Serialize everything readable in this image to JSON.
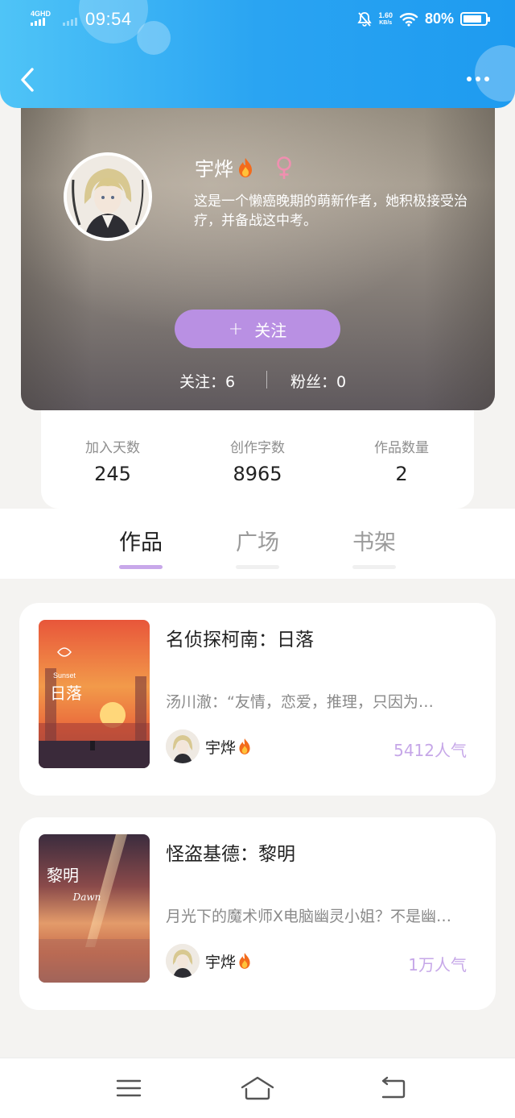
{
  "status_bar": {
    "network": "4GHD",
    "time": "09:54",
    "speed_value": "1.60",
    "speed_unit": "KB/s",
    "battery": "80%"
  },
  "profile": {
    "name": "宇烨",
    "bio": "这是一个懒癌晚期的萌新作者，她积极接受治疗，并备战这中考。",
    "follow_button": "关注",
    "following": "关注：6",
    "fans": "粉丝：0"
  },
  "stats": [
    {
      "label": "加入天数",
      "value": "245"
    },
    {
      "label": "创作字数",
      "value": "8965"
    },
    {
      "label": "作品数量",
      "value": "2"
    }
  ],
  "tabs": [
    {
      "label": "作品",
      "active": true
    },
    {
      "label": "广场",
      "active": false
    },
    {
      "label": "书架",
      "active": false
    }
  ],
  "works": [
    {
      "title": "名侦探柯南：日落",
      "description": "汤川澈：“友情，恋爱，推理，只因为…",
      "author": "宇烨",
      "popularity": "5412人气",
      "cover_text": "日落",
      "cover_sub": "Sunset"
    },
    {
      "title": "怪盗基德：黎明",
      "description": "月光下的魔术师X电脑幽灵小姐？不是幽…",
      "author": "宇烨",
      "popularity": "1万人气",
      "cover_text": "黎明",
      "cover_sub": "Dawn"
    }
  ],
  "colors": {
    "header_gradient_start": "#4fc4f7",
    "header_gradient_end": "#1e9bf0",
    "accent_purple": "#b990e3",
    "popularity_purple": "#c6a7e8"
  }
}
